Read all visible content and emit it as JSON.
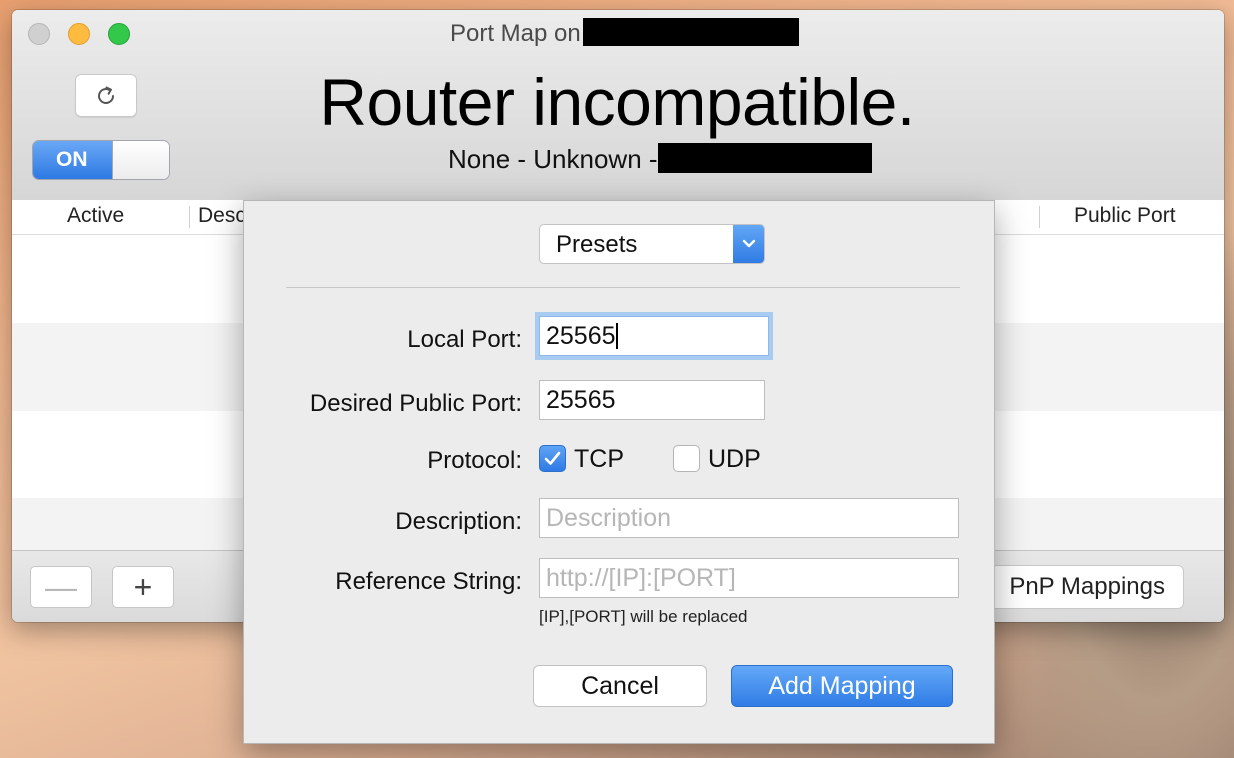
{
  "window": {
    "title": "Port Map on",
    "status_title": "Router incompatible.",
    "status_sub": "None - Unknown -",
    "toggle_label": "ON"
  },
  "table": {
    "columns": [
      "Active",
      "Desc",
      "Public Port"
    ]
  },
  "bottombar": {
    "minus_label": "—",
    "plus_label": "+",
    "upnp_label": "PnP Mappings"
  },
  "sheet": {
    "presets_label": "Presets",
    "local_port_label": "Local Port:",
    "local_port_value": "25565",
    "public_port_label": "Desired Public Port:",
    "public_port_value": "25565",
    "protocol_label": "Protocol:",
    "tcp_label": "TCP",
    "udp_label": "UDP",
    "tcp_checked": true,
    "udp_checked": false,
    "description_label": "Description:",
    "description_placeholder": "Description",
    "reference_label": "Reference String:",
    "reference_placeholder": "http://[IP]:[PORT]",
    "hint": "[IP],[PORT] will be replaced",
    "cancel_label": "Cancel",
    "add_label": "Add Mapping"
  },
  "colors": {
    "accent": "#2f7be4",
    "traffic_min": "#fdbc40",
    "traffic_max": "#34c84a"
  },
  "icons": [
    "refresh-icon",
    "chevron-down-icon",
    "checkmark-icon"
  ]
}
